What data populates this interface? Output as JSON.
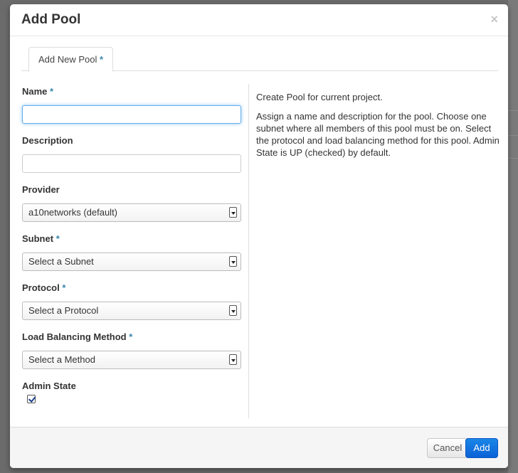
{
  "modal": {
    "title": "Add Pool",
    "close": "×"
  },
  "tabs": [
    {
      "label": "Add New Pool",
      "required": "*"
    }
  ],
  "form": {
    "name": {
      "label": "Name",
      "required": "*",
      "value": ""
    },
    "description": {
      "label": "Description",
      "value": ""
    },
    "provider": {
      "label": "Provider",
      "selected": "a10networks (default)"
    },
    "subnet": {
      "label": "Subnet",
      "required": "*",
      "selected": "Select a Subnet"
    },
    "protocol": {
      "label": "Protocol",
      "required": "*",
      "selected": "Select a Protocol"
    },
    "lb_method": {
      "label": "Load Balancing Method",
      "required": "*",
      "selected": "Select a Method"
    },
    "admin_state": {
      "label": "Admin State",
      "checked": true
    }
  },
  "help": {
    "p1": "Create Pool for current project.",
    "p2": "Assign a name and description for the pool. Choose one subnet where all members of this pool must be on. Select the protocol and load balancing method for this pool. Admin State is UP (checked) by default."
  },
  "footer": {
    "cancel_label": "Cancel",
    "add_label": "Add"
  },
  "colors": {
    "required": "#3a87ad",
    "primary": "#0b62d6"
  }
}
